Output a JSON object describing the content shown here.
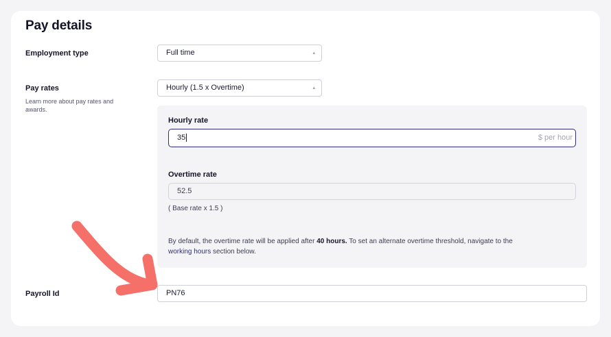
{
  "section": {
    "title": "Pay details"
  },
  "employment_type": {
    "label": "Employment type",
    "selected": "Full time"
  },
  "pay_rates": {
    "label": "Pay rates",
    "help": "Learn more about pay rates and awards.",
    "selected": "Hourly (1.5 x Overtime)"
  },
  "hourly_rate": {
    "label": "Hourly rate",
    "value": "35",
    "unit": "$ per hour"
  },
  "overtime_rate": {
    "label": "Overtime rate",
    "value": "52.5",
    "hint": "( Base rate x 1.5 )"
  },
  "overtime_note": {
    "prefix": "By default, the overtime rate will be applied after ",
    "hours": "40 hours.",
    "middle": " To set an alternate overtime threshold, navigate to the ",
    "link": "working hours",
    "suffix": " section below."
  },
  "payroll_id": {
    "label": "Payroll Id",
    "value": "PN76"
  },
  "colors": {
    "accent": "#2e2d7a",
    "annotation_arrow": "#f47068",
    "panel_bg": "#f4f4f7"
  },
  "icons": {
    "select_caret": "caret-updown-icon",
    "annotation": "curved-arrow-icon"
  }
}
